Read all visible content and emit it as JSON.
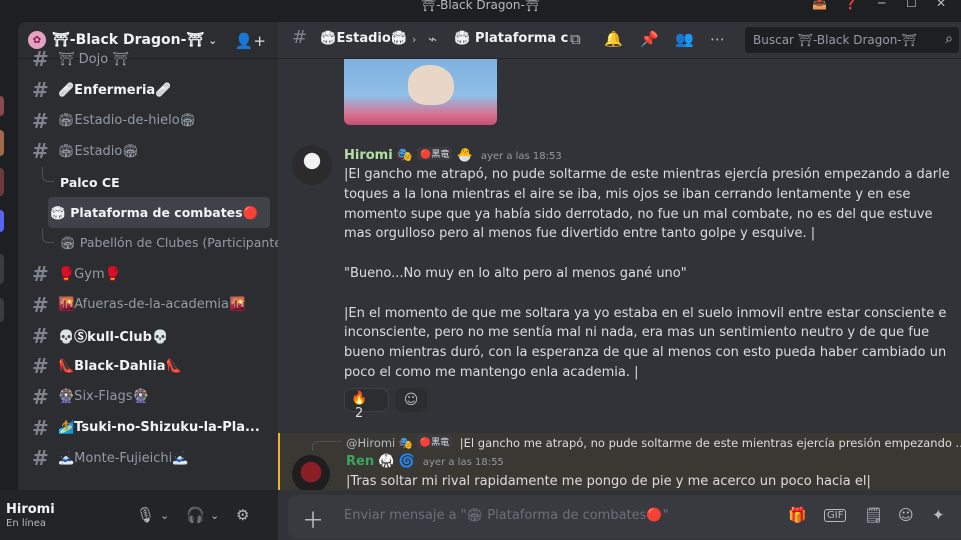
{
  "window": {
    "title": "⛩-Black Dragon-⛩",
    "controls": [
      "─",
      "☐",
      "✕"
    ]
  },
  "colors": {
    "accent_gold": "#f0b232",
    "hiromi_name": "#b6e0a3",
    "ren_name": "#3ba55c",
    "bg": "#313338",
    "sidebar": "#2b2d31"
  },
  "guild": {
    "name": "⛩-Black Dragon-⛩"
  },
  "channels": [
    {
      "kind": "channel",
      "name": "⛩ Dojo ⛩",
      "bold": false,
      "unread": false
    },
    {
      "kind": "channel",
      "name": "🩹Enfermeria🩹",
      "bold": true,
      "unread": true
    },
    {
      "kind": "channel",
      "name": "🏟Estadio-de-hielo🏟",
      "bold": false,
      "unread": false
    },
    {
      "kind": "channel",
      "name": "🏟Estadio🏟",
      "bold": false,
      "unread": false
    },
    {
      "kind": "thread",
      "name": "Palco CE",
      "bold": true,
      "unread": true,
      "selected": false
    },
    {
      "kind": "thread",
      "name": "🏟 Plataforma de combates🔴",
      "bold": true,
      "unread": false,
      "selected": true
    },
    {
      "kind": "thread",
      "name": "🏟 Pabellón de Clubes (Participante...",
      "bold": false,
      "unread": false,
      "selected": false
    },
    {
      "kind": "channel",
      "name": "🥊Gym🥊",
      "bold": false,
      "unread": false
    },
    {
      "kind": "channel",
      "name": "🌇Afueras-de-la-academia🌇",
      "bold": false,
      "unread": false
    },
    {
      "kind": "channel",
      "name": "💀Ⓢkull-Club💀",
      "bold": true,
      "unread": true
    },
    {
      "kind": "channel",
      "name": "👠Black-Dahlia👠",
      "bold": true,
      "unread": true
    },
    {
      "kind": "channel",
      "name": "🎡Six-Flags🎡",
      "bold": false,
      "unread": false
    },
    {
      "kind": "channel",
      "name": "🏄Tsuki-no-Shizuku-la-Pla...",
      "bold": true,
      "unread": true
    },
    {
      "kind": "channel",
      "name": "🗻Monte-Fujieichi🗻",
      "bold": false,
      "unread": false
    }
  ],
  "user": {
    "name": "Hiromi",
    "status": "En línea"
  },
  "topbar": {
    "crumb1": "🏟Estadio🏟",
    "crumb2": "🏟 Plataforma c",
    "search_placeholder": "Buscar ⛩-Black Dragon-⛩"
  },
  "messages": [
    {
      "author": "Hiromi",
      "badges": "🎭",
      "tag": "🔴黑竜",
      "extra_emoji": "🐣",
      "time": "ayer a las 18:53",
      "paragraphs": [
        "|El gancho me atrapó, no pude soltarme de este mientras ejercía presión empezando a darle toques a la lona mientras el aire se iba, mis ojos se iban cerrando lentamente y en ese momento supe que ya había sido derrotado, no fue un mal combate, no es del que estuve mas orgulloso pero al menos fue divertido entre tanto golpe y esquive. |",
        "\"Bueno...No muy en lo alto pero al menos gané uno\"",
        "|En el momento de que me soltara ya yo estaba en el suelo inmovil entre estar consciente e inconsciente, pero no me sentía mal ni nada, era mas un sentimiento neutro y de que fue bueno mientras duró, con la esperanza de que al menos con esto pueda haber cambiado un poco el como me mantengo enla academia. |"
      ],
      "reaction": {
        "emoji": "🔥",
        "count": "2"
      }
    },
    {
      "reply_to": "@Hiromi",
      "reply_badges": "🎭",
      "reply_tag": "🔴黑竜",
      "reply_text": "|El gancho me atrapó, no pude soltarme de este mientras ejercía presión empezando ...",
      "author": "Ren",
      "badges": "🥋",
      "extra_emoji": "🌀",
      "time": "ayer a las 18:55",
      "text": "|Tras soltar mi rival rapidamente me pongo de pie y me acerco un poco hacia el|"
    }
  ],
  "composer": {
    "placeholder": "Enviar mensaje a \"🏟 Plataforma de combates🔴\""
  }
}
